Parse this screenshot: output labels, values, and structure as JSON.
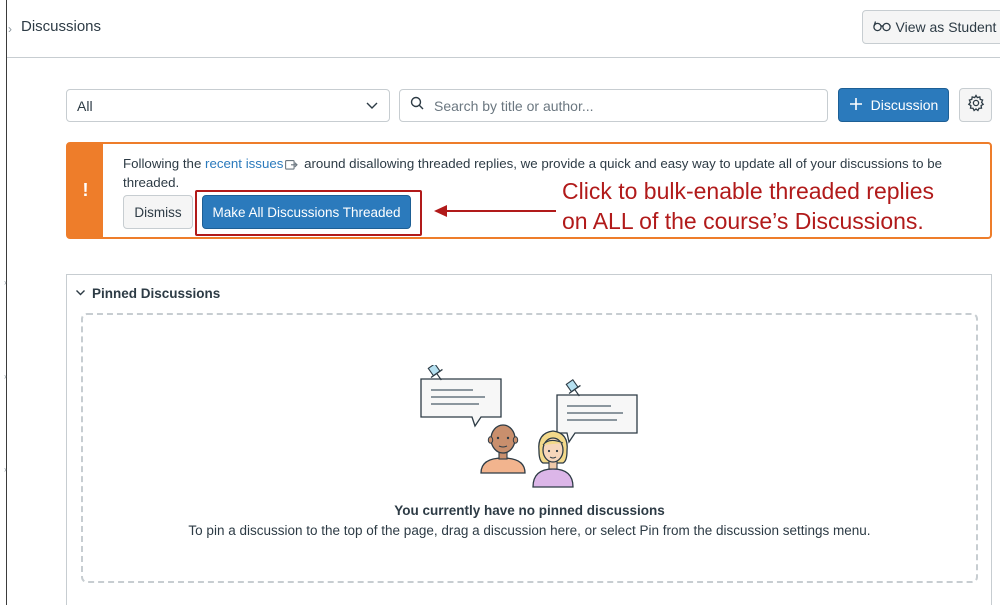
{
  "header": {
    "title": "Discussions",
    "view_as_student_label": "View as Student"
  },
  "toolbar": {
    "filter_value": "All",
    "search_placeholder": "Search by title or author...",
    "add_discussion_label": "Discussion"
  },
  "alert": {
    "text_before_link": "Following the ",
    "link_text": "recent issues",
    "text_after_link": " around disallowing threaded replies, we provide a quick and easy way to update all of your discussions to be threaded.",
    "dismiss_label": "Dismiss",
    "make_threaded_label": "Make All Discussions Threaded"
  },
  "annotation": {
    "line1": "Click to bulk-enable threaded replies",
    "line2": "on ALL of the course’s Discussions."
  },
  "pinned": {
    "section_title": "Pinned Discussions",
    "empty_title": "You currently have no pinned discussions",
    "empty_description": "To pin a discussion to the top of the page, drag a discussion here, or select Pin from the discussion settings menu."
  },
  "colors": {
    "brand_blue": "#2b7abc",
    "warning_orange": "#ee7d2a",
    "annotation_red": "#b11a1a"
  }
}
